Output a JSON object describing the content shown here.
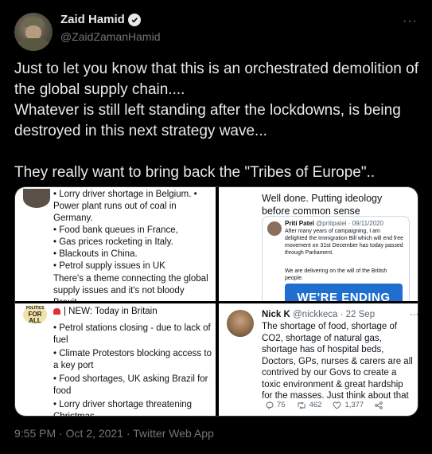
{
  "author": {
    "name": "Zaid Hamid",
    "handle": "@ZaidZamanHamid"
  },
  "tweet_text": "Just to let you know that this is an orchestrated demolition of the global supply chain....\nWhatever is still left standing after the lockdowns, is being destroyed in this next strategy wave...\n\nThey really want to bring back the \"Tribes of Europe\"..",
  "media": {
    "panel1": {
      "list": "• Lorry driver shortage in Belgium. •\nPower plant runs out of coal in Germany.\n• Food bank queues in France,\n• Gas prices rocketing in Italy.\n• Blackouts in China.\n• Petrol supply issues in UK",
      "note": "There's a theme connecting the global supply issues and it's not bloody Brexit."
    },
    "panel2": {
      "head": "Well done. Putting ideology before common sense",
      "embed_name": "Priti Patel",
      "embed_handle": "@pritipatel · 09/11/2020",
      "embed_text": "After many years of campaigning, I am delighted the Immigration Bill which will end free movement on 31st December has today passed through Parliament.",
      "embed_text2": "We are delivering on the will of the British people.",
      "banner": "WE'RE ENDING"
    },
    "panel3": {
      "logo_l1": "POLITICS",
      "logo_l2": "FOR",
      "logo_l3": "ALL",
      "header": "| NEW: Today in Britain",
      "items": [
        "• Petrol stations closing - due to lack of fuel",
        "• Climate Protestors blocking access to a key port",
        "• Food shortages, UK asking Brazil for food",
        "• Lorry driver shortage threatening Christmas"
      ]
    },
    "panel4": {
      "name": "Nick K",
      "handle": "@nickkeca",
      "date": "· 22 Sep",
      "more": "···",
      "body": "The shortage of food, shortage of CO2, shortage of natural gas, shortage has of hospital beds, Doctors, GPs, nurses & carers are all contrived by our Govs to create a toxic environment & great hardship for the masses. Just think about that",
      "replies": "75",
      "retweets": "462",
      "likes": "1,377"
    }
  },
  "timestamp": "9:55 PM · Oct 2, 2021 · Twitter Web App",
  "more_label": "···"
}
